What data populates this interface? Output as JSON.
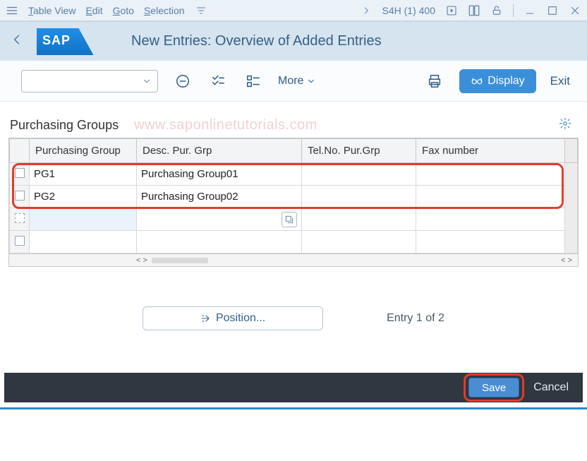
{
  "menubar": {
    "items": [
      {
        "label": "Table View",
        "ul": "T",
        "rest": "able View"
      },
      {
        "label": "Edit",
        "ul": "E",
        "rest": "dit"
      },
      {
        "label": "Goto",
        "ul": "G",
        "rest": "oto"
      },
      {
        "label": "Selection",
        "ul": "S",
        "rest": "election"
      }
    ],
    "system": "S4H (1) 400"
  },
  "header": {
    "logo": "SAP",
    "title": "New Entries: Overview of Added Entries"
  },
  "toolbar": {
    "more": "More",
    "display": "Display",
    "exit": "Exit"
  },
  "section": {
    "title": "Purchasing Groups",
    "watermark": "www.saponlinetutorials.com"
  },
  "table": {
    "columns": [
      "Purchasing Group",
      "Desc. Pur. Grp",
      "Tel.No. Pur.Grp",
      "Fax number"
    ],
    "rows": [
      {
        "pg": "PG1",
        "desc": "Purchasing Group01",
        "tel": "",
        "fax": ""
      },
      {
        "pg": "PG2",
        "desc": "Purchasing Group02",
        "tel": "",
        "fax": ""
      }
    ]
  },
  "status": {
    "position": "Position...",
    "entry": "Entry 1 of 2"
  },
  "footer": {
    "save": "Save",
    "cancel": "Cancel"
  }
}
